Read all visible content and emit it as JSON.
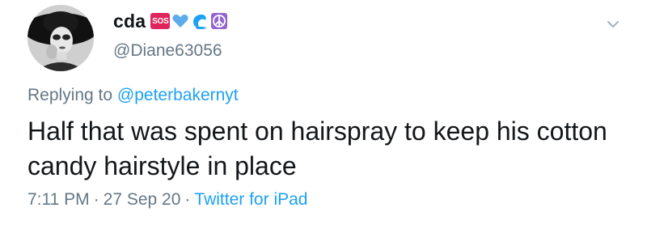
{
  "author": {
    "display_name": "cda",
    "handle": "@Diane63056",
    "badges": [
      {
        "type": "text-badge",
        "label": "SOS",
        "color": "#e0245e"
      },
      {
        "type": "icon",
        "name": "blue-heart-icon",
        "color": "#5dadec"
      },
      {
        "type": "icon",
        "name": "wave-icon",
        "color": "#1da1f2"
      },
      {
        "type": "icon",
        "name": "peace-symbol-icon",
        "color": "#9266cc"
      }
    ]
  },
  "reply": {
    "prefix": "Replying to",
    "mention": "@peterbakernyt"
  },
  "tweet": {
    "text": "Half that was spent on hairspray to keep his cotton candy hairstyle in place"
  },
  "meta": {
    "time": "7:11 PM",
    "separator": "·",
    "date": "27 Sep 20",
    "source": "Twitter for iPad"
  },
  "colors": {
    "text": "#14171a",
    "secondary": "#657786",
    "link": "#1da1f2"
  },
  "icons": {
    "menu": "chevron-down-icon",
    "avatar": "profile-photo"
  }
}
